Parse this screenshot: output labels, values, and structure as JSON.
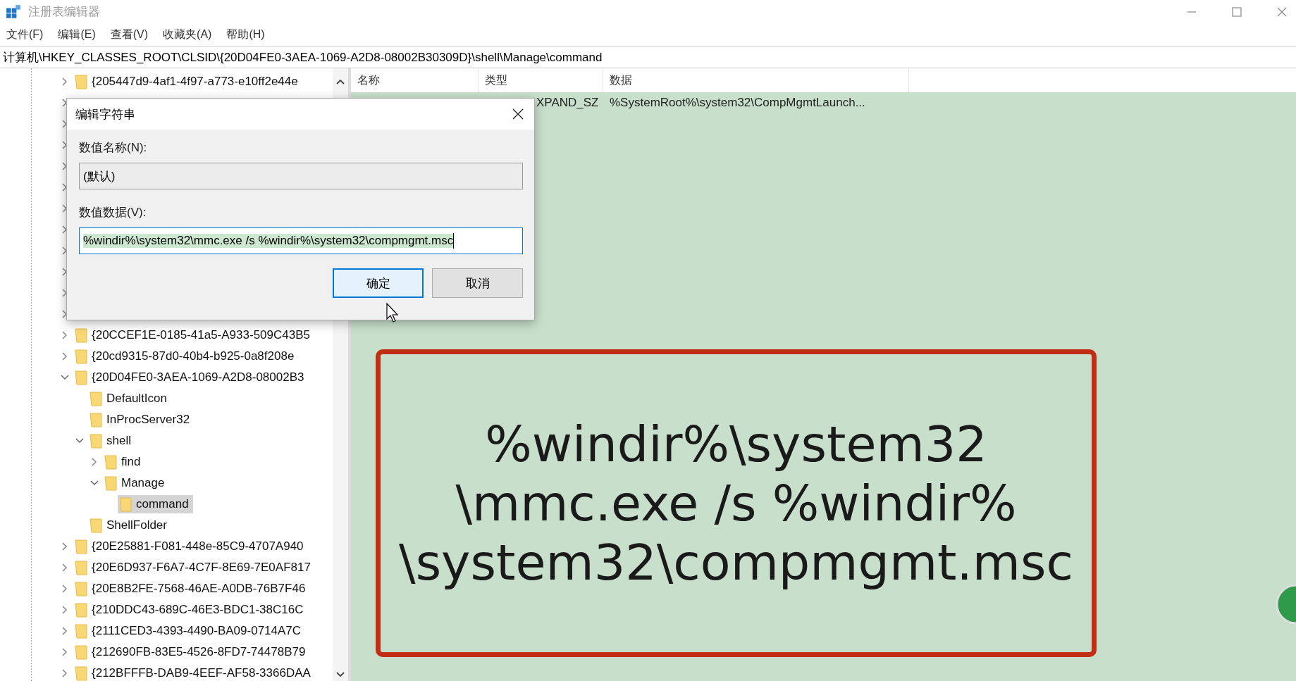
{
  "window": {
    "title": "注册表编辑器"
  },
  "menu": [
    "文件(F)",
    "编辑(E)",
    "查看(V)",
    "收藏夹(A)",
    "帮助(H)"
  ],
  "address": "计算机\\HKEY_CLASSES_ROOT\\CLSID\\{20D04FE0-3AEA-1069-A2D8-08002B30309D}\\shell\\Manage\\command",
  "tree": [
    {
      "label": "{205447d9-4af1-4f97-a773-e10ff2e44e",
      "expanded": false,
      "selected": false
    },
    {
      "kind": "covered",
      "expanded": false
    },
    {
      "kind": "covered",
      "expanded": false
    },
    {
      "kind": "covered",
      "expanded": false
    },
    {
      "kind": "covered",
      "expanded": false
    },
    {
      "kind": "covered",
      "expanded": false
    },
    {
      "kind": "covered",
      "expanded": false
    },
    {
      "kind": "covered",
      "expanded": false
    },
    {
      "kind": "covered",
      "expanded": false
    },
    {
      "kind": "covered",
      "expanded": false
    },
    {
      "kind": "covered",
      "expanded": false
    },
    {
      "kind": "covered",
      "expanded": false
    },
    {
      "label": "{20CCEF1E-0185-41a5-A933-509C43B5",
      "expanded": false,
      "selected": false
    },
    {
      "label": "{20cd9315-87d0-40b4-b925-0a8f208e",
      "expanded": false,
      "selected": false
    },
    {
      "label": "{20D04FE0-3AEA-1069-A2D8-08002B3",
      "expanded": true,
      "selected": false,
      "children": [
        {
          "label": "DefaultIcon",
          "selected": false
        },
        {
          "label": "InProcServer32",
          "selected": false
        },
        {
          "label": "shell",
          "expanded": true,
          "selected": false,
          "children": [
            {
              "label": "find",
              "expanded": false,
              "selected": false
            },
            {
              "label": "Manage",
              "expanded": true,
              "selected": false,
              "children": [
                {
                  "label": "command",
                  "selected": true
                }
              ]
            }
          ]
        },
        {
          "label": "ShellFolder",
          "selected": false
        }
      ]
    },
    {
      "label": "{20E25881-F081-448e-85C9-4707A940",
      "expanded": false,
      "selected": false
    },
    {
      "label": "{20E6D937-F6A7-4C7F-8E69-7E0AF817",
      "expanded": false,
      "selected": false
    },
    {
      "label": "{20E8B2FE-7568-46AE-A0DB-76B7F46",
      "expanded": false,
      "selected": false
    },
    {
      "label": "{210DDC43-689C-46E3-BDC1-38C16C",
      "expanded": false,
      "selected": false
    },
    {
      "label": "{2111CED3-4393-4490-BA09-0714A7C",
      "expanded": false,
      "selected": false
    },
    {
      "label": "{212690FB-83E5-4526-8FD7-74478B79",
      "expanded": false,
      "selected": false
    },
    {
      "label": "{212BFFFB-DAB9-4EEF-AF58-3366DAA",
      "expanded": false,
      "selected": false
    }
  ],
  "table": {
    "columns": [
      "名称",
      "类型",
      "数据"
    ],
    "rows": [
      {
        "type": "XPAND_SZ",
        "data": "%SystemRoot%\\system32\\CompMgmtLaunch..."
      }
    ]
  },
  "dialog": {
    "title": "编辑字符串",
    "name_label": "数值名称(N):",
    "name_value": "(默认)",
    "data_label": "数值数据(V):",
    "data_value": "%windir%\\system32\\mmc.exe /s %windir%\\system32\\compmgmt.msc",
    "buttons": [
      {
        "label": "确定",
        "focused": true
      },
      {
        "label": "取消",
        "focused": false
      }
    ]
  },
  "callout": {
    "lines": [
      "%windir%\\system32",
      "\\mmc.exe /s %windir%",
      "\\system32\\compmgmt.msc"
    ]
  }
}
